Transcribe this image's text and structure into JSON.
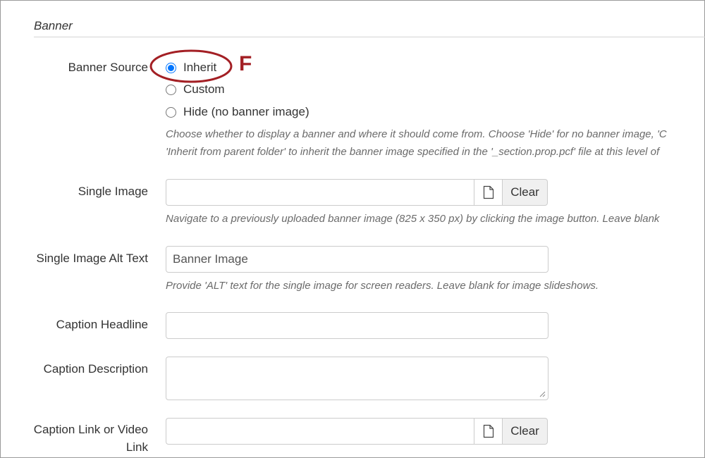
{
  "section": {
    "title": "Banner"
  },
  "banner_source": {
    "label": "Banner Source",
    "options": [
      {
        "label": "Inherit",
        "selected": true
      },
      {
        "label": "Custom",
        "selected": false
      },
      {
        "label": "Hide (no banner image)",
        "selected": false
      }
    ],
    "help_line1": "Choose whether to display a banner and where it should come from. Choose 'Hide' for no banner image, 'C",
    "help_line2": "'Inherit from parent folder' to inherit the banner image specified in the '_section.prop.pcf' file at this level of"
  },
  "single_image": {
    "label": "Single Image",
    "value": "",
    "clear_label": "Clear",
    "help": "Navigate to a previously uploaded banner image (825 x 350 px) by clicking the image button. Leave blank"
  },
  "alt_text": {
    "label": "Single Image Alt Text",
    "value": "Banner Image",
    "help": "Provide 'ALT' text for the single image for screen readers. Leave blank for image slideshows."
  },
  "caption_headline": {
    "label": "Caption Headline",
    "value": ""
  },
  "caption_description": {
    "label": "Caption Description",
    "value": ""
  },
  "caption_link": {
    "label_line1": "Caption Link or Video",
    "label_line2": "Link",
    "value": "",
    "clear_label": "Clear"
  },
  "annotation": {
    "letter": "F",
    "color": "#a31f24"
  },
  "colors": {
    "radio_accent": "#0075ff",
    "border": "#cccccc",
    "help_text": "#6b6b6b"
  }
}
